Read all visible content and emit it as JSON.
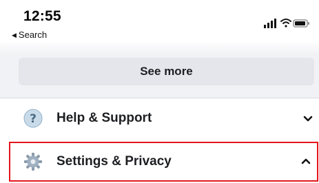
{
  "status_bar": {
    "time": "12:55",
    "back_label": "Search",
    "icons": [
      "signal-icon",
      "wifi-icon",
      "battery-icon"
    ]
  },
  "see_more": {
    "label": "See more"
  },
  "menu": {
    "help": {
      "label": "Help & Support",
      "icon": "question-icon",
      "chevron": "chevron-down-icon",
      "expanded": false
    },
    "settings": {
      "label": "Settings & Privacy",
      "icon": "gear-icon",
      "chevron": "chevron-up-icon",
      "expanded": true,
      "highlight_color": "#e5141a"
    }
  },
  "colors": {
    "button_bg": "#e4e6eb",
    "feed_bg": "#f0f2f5",
    "text": "#1c1e21",
    "highlight": "#e5141a"
  }
}
